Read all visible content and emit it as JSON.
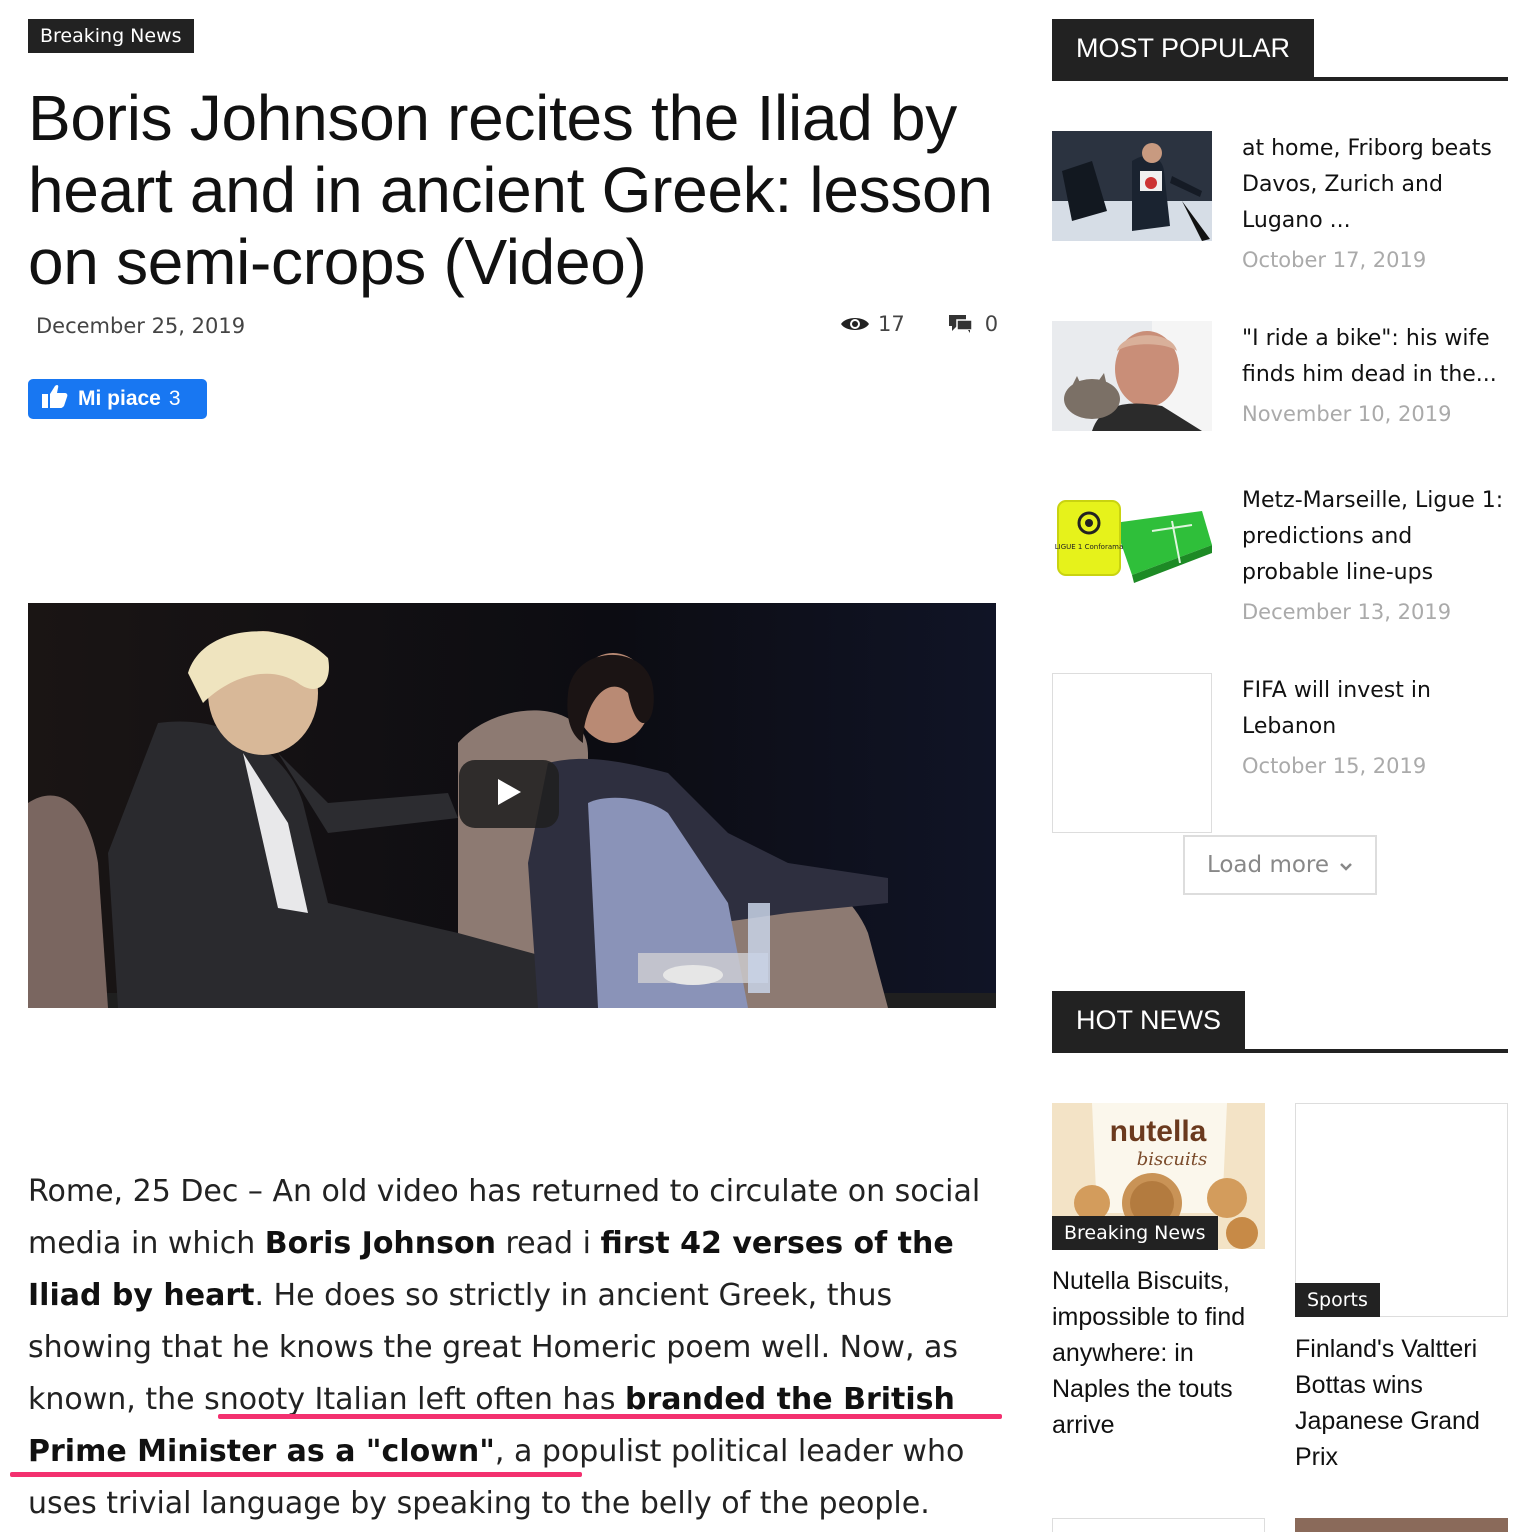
{
  "article": {
    "category": "Breaking News",
    "title": "Boris Johnson recites the Iliad by heart and in ancient Greek: lesson on semi-crops (Video)",
    "date": "December 25, 2019",
    "views": "17",
    "comments": "0",
    "like_label": "Mi piace",
    "like_count": "3",
    "body": {
      "s1": "Rome, 25 Dec – An old video has returned to circulate on social media in which ",
      "b1": "Boris Johnson",
      "s2": " read i ",
      "b2": "first 42 verses of the Iliad by heart",
      "s3": ". He does so strictly in ancient Greek, thus showing that he knows the great Homeric poem well. Now, as known, the snooty Italian left often has ",
      "b3": "branded the British Prime Minister as a \"clown\"",
      "s4": ", a populist political leader who uses trivial language by speaking to the belly of the people."
    }
  },
  "most_popular": {
    "heading": "MOST POPULAR",
    "items": [
      {
        "title": "at home, Friborg beats Davos, Zurich and Lugano ...",
        "date": "October 17, 2019"
      },
      {
        "title": "\"I ride a bike\": his wife finds him dead in the...",
        "date": "November 10, 2019"
      },
      {
        "title": "Metz-Marseille, Ligue 1: predictions and probable line-ups",
        "date": "December 13, 2019"
      },
      {
        "title": "FIFA will invest in Lebanon",
        "date": "October 15, 2019"
      }
    ],
    "load_more": "Load more",
    "ligue_logo_text": "LIGUE 1 Conforama"
  },
  "hot_news": {
    "heading": "HOT NEWS",
    "items": [
      {
        "category": "Breaking News",
        "title": "Nutella Biscuits, impossible to find anywhere: in Naples the touts arrive",
        "logo_text": "nutella",
        "logo_sub": "biscuits"
      },
      {
        "category": "Sports",
        "title": "Finland's Valtteri Bottas wins Japanese Grand Prix"
      }
    ]
  },
  "colors": {
    "like_blue": "#1877f2",
    "highlight_pink": "#f3306f",
    "dark_label": "#222222"
  }
}
